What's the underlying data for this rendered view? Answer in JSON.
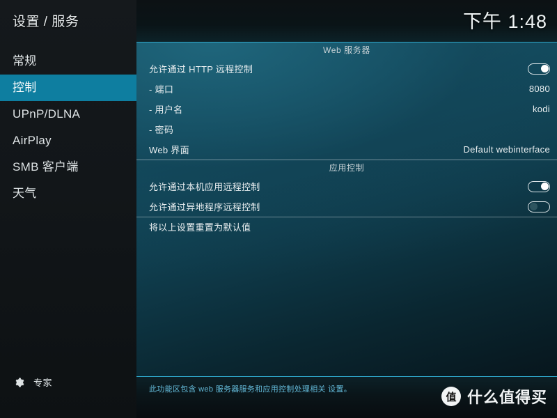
{
  "sidebar": {
    "title": "设置 / 服务",
    "items": [
      {
        "label": "常规",
        "selected": false
      },
      {
        "label": "控制",
        "selected": true
      },
      {
        "label": "UPnP/DLNA",
        "selected": false
      },
      {
        "label": "AirPlay",
        "selected": false
      },
      {
        "label": "SMB 客户端",
        "selected": false
      },
      {
        "label": "天气",
        "selected": false
      }
    ],
    "expert": {
      "icon": "gear-icon",
      "label": "专家"
    }
  },
  "topbar": {
    "clock": "下午 1:48"
  },
  "content": {
    "sections": [
      {
        "title": "Web 服务器",
        "divider": "cyan",
        "rows": [
          {
            "label": "允许通过 HTTP 远程控制",
            "control": "toggle",
            "state": "on"
          },
          {
            "label": "- 端口",
            "control": "value",
            "value": "8080"
          },
          {
            "label": "- 用户名",
            "control": "value",
            "value": "kodi"
          },
          {
            "label": "- 密码",
            "control": "value",
            "value": ""
          },
          {
            "label": "Web 界面",
            "control": "value",
            "value": "Default webinterface"
          }
        ]
      },
      {
        "title": "应用控制",
        "divider": "grey",
        "rows": [
          {
            "label": "允许通过本机应用远程控制",
            "control": "toggle",
            "state": "on"
          },
          {
            "label": "允许通过异地程序远程控制",
            "control": "toggle",
            "state": "off"
          },
          {
            "label": "将以上设置重置为默认值",
            "control": "none",
            "dividerTop": true
          }
        ]
      }
    ]
  },
  "footer": {
    "help_text": "此功能区包含 web 服务器服务和应用控制处理相关 设置。",
    "watermark": {
      "mark": "值",
      "text": "什么值得买"
    }
  },
  "colors": {
    "accent_teal": "#0e7ea0",
    "divider_cyan": "#2fa8cc",
    "help_text": "#63b9d8",
    "sidebar_bg": "#13171a"
  }
}
